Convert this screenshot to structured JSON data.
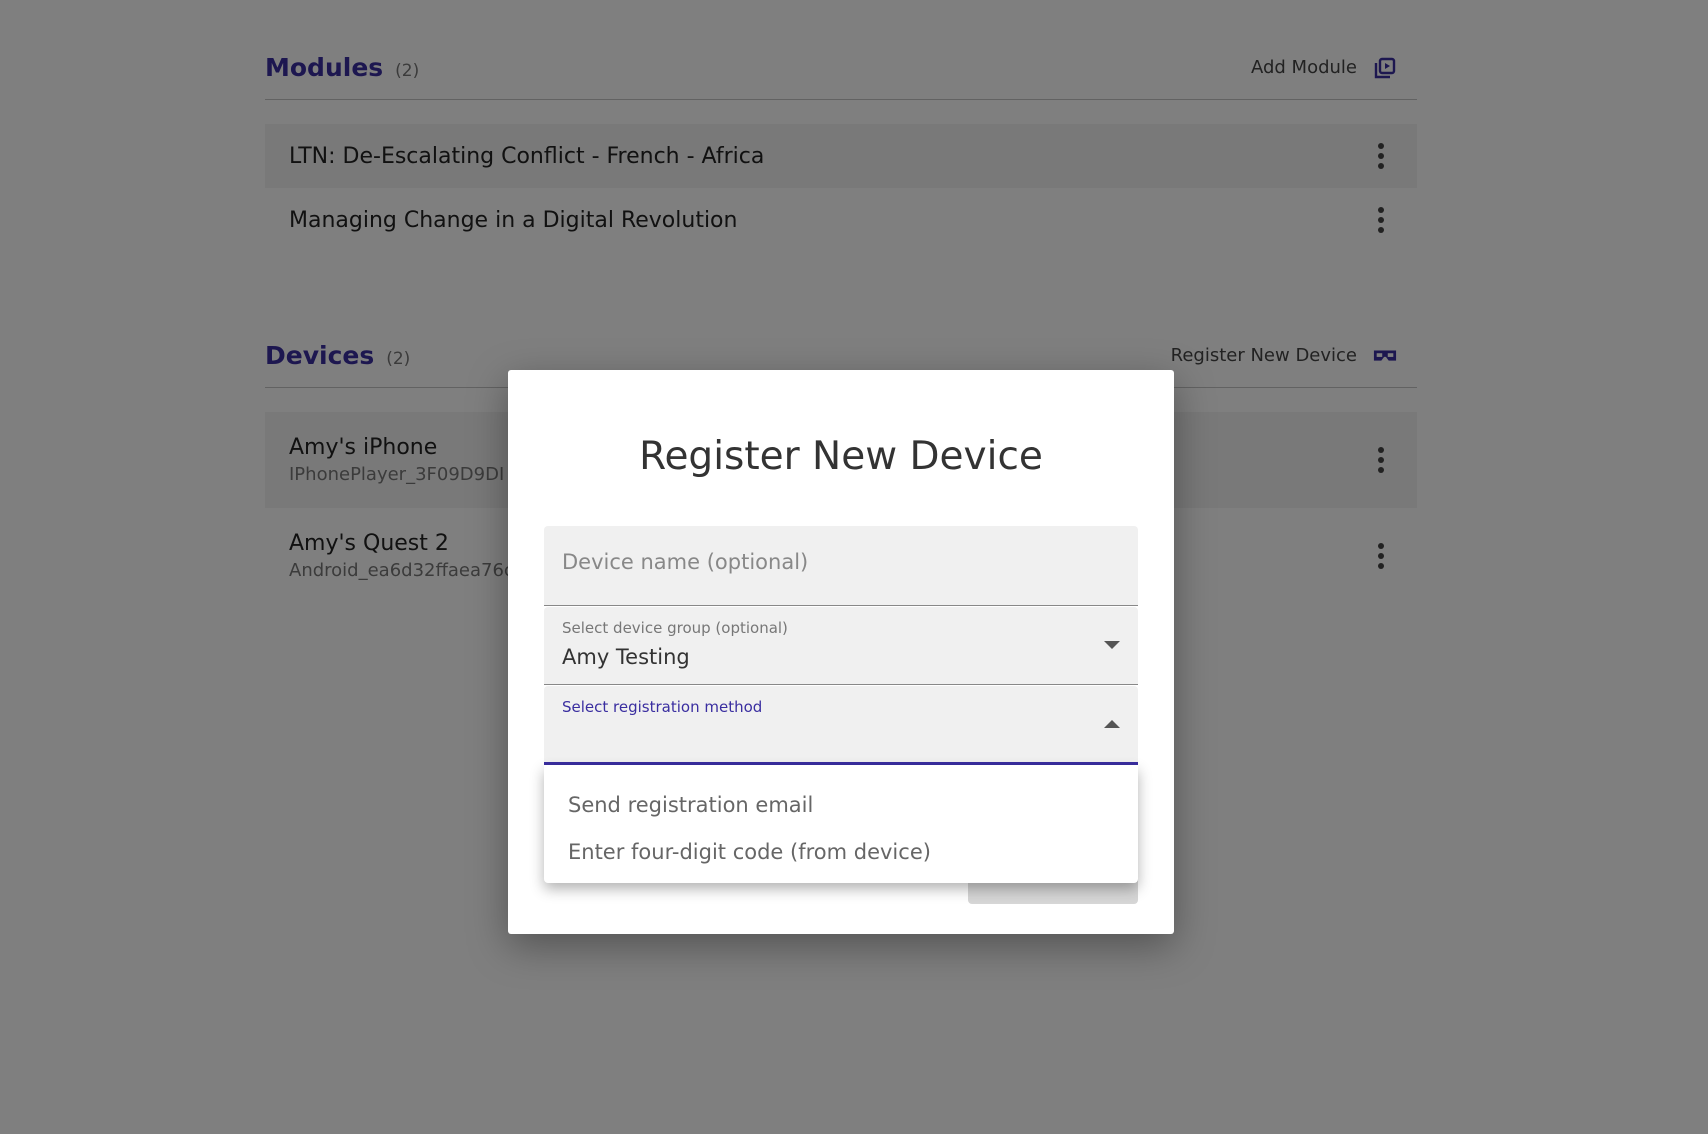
{
  "modules": {
    "title": "Modules",
    "count": "(2)",
    "action_label": "Add Module",
    "action_icon": "add-video-icon",
    "items": [
      {
        "name": "LTN: De-Escalating Conflict - French - Africa"
      },
      {
        "name": "Managing Change in a Digital Revolution"
      }
    ]
  },
  "devices": {
    "title": "Devices",
    "count": "(2)",
    "action_label": "Register New Device",
    "action_icon": "vr-headset-icon",
    "items": [
      {
        "name": "Amy's iPhone",
        "id": "IPhonePlayer_3F09D9DI"
      },
      {
        "name": "Amy's Quest 2",
        "id": "Android_ea6d32ffaea76c"
      }
    ]
  },
  "dialog": {
    "title": "Register New Device",
    "device_name_placeholder": "Device name (optional)",
    "group_label": "Select device group (optional)",
    "group_value": "Amy Testing",
    "method_label": "Select registration method",
    "method_value": "",
    "method_options": [
      "Send registration email",
      "Enter four-digit code (from device)"
    ]
  },
  "colors": {
    "accent": "#3a2ea0",
    "overlay": "rgba(0,0,0,0.5)"
  }
}
